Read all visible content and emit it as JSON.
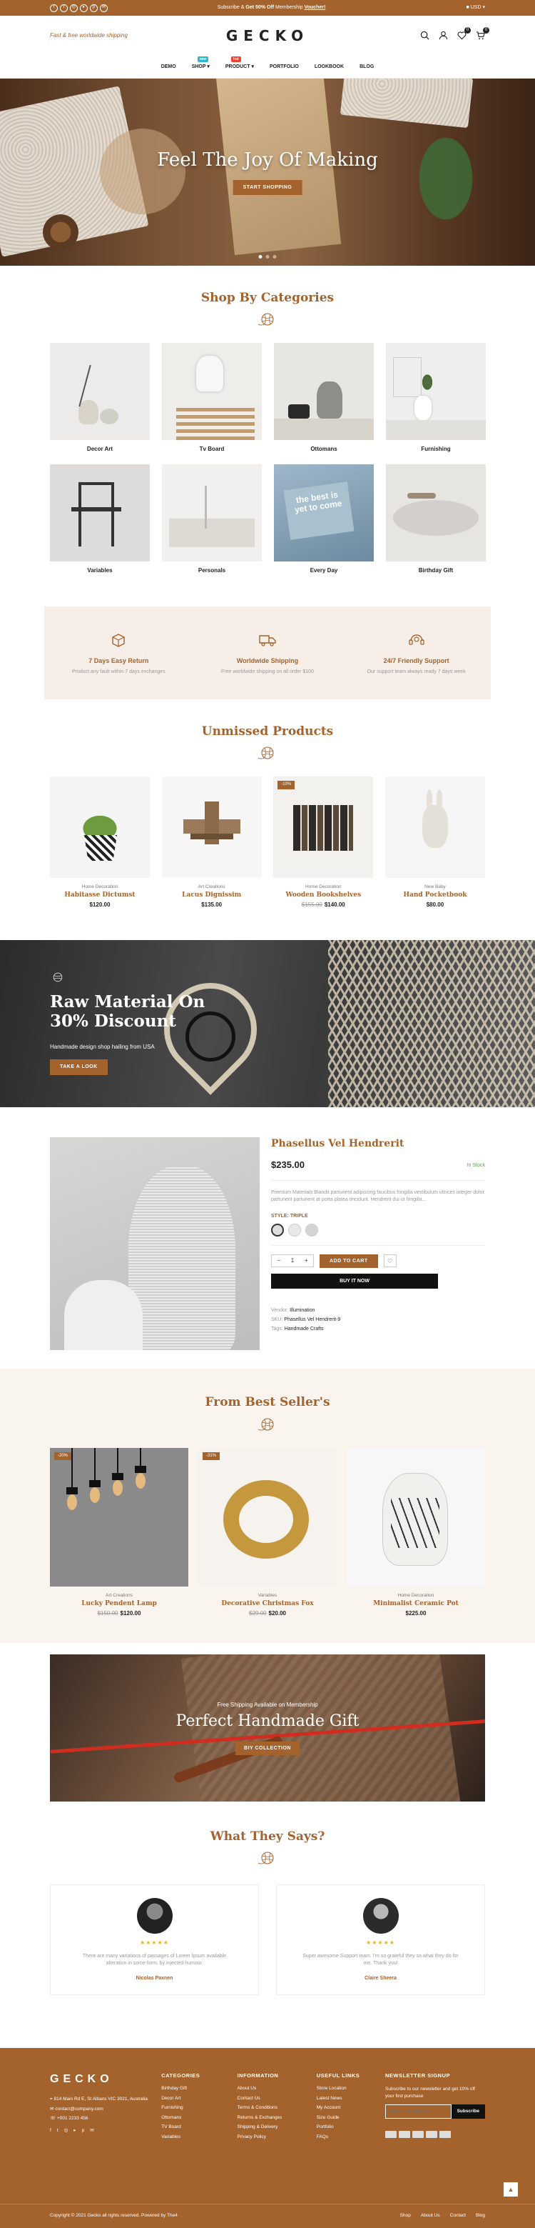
{
  "topbar": {
    "social_icons": [
      "facebook-icon",
      "twitter-icon",
      "instagram-icon",
      "youtube-icon",
      "pinterest-icon",
      "mail-icon"
    ],
    "promo_prefix": "Subscribe & ",
    "promo_highlight": "Get 50% Off",
    "promo_suffix": " Membership ",
    "promo_link": "Voucher!",
    "currency": "USD"
  },
  "header": {
    "tagline": "Fast & free worldwide shipping",
    "logo": "GECKO",
    "wishlist_count": "0",
    "cart_count": "0"
  },
  "nav": {
    "items": [
      {
        "label": "DEMO"
      },
      {
        "label": "SHOP",
        "badge": "new",
        "badge_color": "#2bb6d4"
      },
      {
        "label": "PRODUCT",
        "badge": "hot",
        "badge_color": "#e8442f"
      },
      {
        "label": "PORTFOLIO"
      },
      {
        "label": "LOOKBOOK"
      },
      {
        "label": "BLOG"
      }
    ]
  },
  "hero": {
    "title": "Feel The Joy Of Making",
    "button": "START SHOPPING"
  },
  "categories": {
    "title": "Shop By Categories",
    "items": [
      {
        "name": "Decor Art"
      },
      {
        "name": "Tv Board"
      },
      {
        "name": "Ottomans"
      },
      {
        "name": "Furnishing"
      },
      {
        "name": "Variables"
      },
      {
        "name": "Personals"
      },
      {
        "name": "Every Day"
      },
      {
        "name": "Birthday Gift"
      }
    ],
    "every_day_caption": "the best is yet to come"
  },
  "features": [
    {
      "title": "7 Days Easy Return",
      "desc": "Product any fault within 7 days exchanges"
    },
    {
      "title": "Worldwide Shipping",
      "desc": "Free worldwide shipping on all order $100"
    },
    {
      "title": "24/7 Friendly Support",
      "desc": "Our support team always ready 7 days week"
    }
  ],
  "unmissed": {
    "title": "Unmissed Products",
    "items": [
      {
        "category": "Home Decoration",
        "name": "Habitasse Dictumst",
        "price": "$120.00",
        "old": "",
        "tag": ""
      },
      {
        "category": "Art Creations",
        "name": "Lacus Dignissim",
        "price": "$135.00",
        "old": "",
        "tag": ""
      },
      {
        "category": "Home Decoration",
        "name": "Wooden Bookshelves",
        "price": "$140.00",
        "old": "$155.00",
        "tag": "-10%"
      },
      {
        "category": "New Baby",
        "name": "Hand Pocketbook",
        "price": "$80.00",
        "old": "",
        "tag": ""
      }
    ]
  },
  "banner": {
    "line1": "Raw Material On",
    "line2": "30% Discount",
    "sub": "Handmade design shop hailing from USA",
    "button": "TAKE A LOOK"
  },
  "featured": {
    "name": "Phasellus Vel Hendrerit",
    "price": "$235.00",
    "stock": "In Stock",
    "desc": "Premium Materials Blandit parturient adipiscing faucibus fringilla vestibulum ultrices integer dolor parturient parturient at porta platea tincidunt. Hendrerit dui ut fringilla...",
    "style_label": "STYLE: TRIPLE",
    "qty": "1",
    "add_to_cart": "ADD TO CART",
    "buy_now": "BUY IT NOW",
    "vendor_label": "Vendor:",
    "vendor": "Illumination",
    "sku_label": "SKU:",
    "sku": "Phasellus Vel Hendrerit-9",
    "tags_label": "Tags:",
    "tags": "Handmade Crafts"
  },
  "bestseller": {
    "title": "From Best Seller's",
    "items": [
      {
        "category": "Art Creations",
        "name": "Lucky Pendent Lamp",
        "price": "$120.00",
        "old": "$150.00",
        "tag": "-20%"
      },
      {
        "category": "Variables",
        "name": "Decorative Christmas Fox",
        "price": "$20.00",
        "old": "$29.00",
        "tag": "-31%"
      },
      {
        "category": "Home Decoration",
        "name": "Minimalist Ceramic Pot",
        "price": "$225.00",
        "old": "",
        "tag": ""
      }
    ]
  },
  "gift": {
    "sub": "Free Shipping Available on Membership",
    "title": "Perfect Handmade Gift",
    "button": "BIY COLLECTION"
  },
  "testimonials": {
    "title": "What They Says?",
    "items": [
      {
        "stars": "★★★★★",
        "text": "There are many variations of passages of Lorem Ipsum available alteration in some form, by injected humour.",
        "author": "Nicolas Paxnen"
      },
      {
        "stars": "★★★★★",
        "text": "Super awesome Support team. I'm so grateful they so what they do for me. Thank you!",
        "author": "Claire Sheera"
      }
    ]
  },
  "footer": {
    "logo": "GECKO",
    "address": "814 Main Rd E, St Albans VIC 3021, Australia",
    "email": "contact@company.com",
    "phone": "+001 2233 456",
    "social_icons": [
      "facebook-icon",
      "twitter-icon",
      "instagram-icon",
      "youtube-icon",
      "pinterest-icon",
      "mail-icon"
    ],
    "cols": [
      {
        "title": "CATEGORIES",
        "links": [
          "Birthday Gift",
          "Decor Art",
          "Furnishing",
          "Ottomans",
          "TV Board",
          "Variables"
        ]
      },
      {
        "title": "INFORMATION",
        "links": [
          "About Us",
          "Contact Us",
          "Terms & Conditions",
          "Returns & Exchanges",
          "Shipping & Delivery",
          "Privacy Policy"
        ]
      },
      {
        "title": "USEFUL LINKS",
        "links": [
          "Store Location",
          "Latest News",
          "My Account",
          "Size Guide",
          "Portfolio",
          "FAQs"
        ]
      }
    ],
    "newsletter_title": "NEWSLETTER SIGNUP",
    "newsletter_desc": "Subscribe to our newsletter and get 10% off your first purchase",
    "newsletter_placeholder": "Your email address",
    "newsletter_button": "Subscribe",
    "copyright": "Copyright © 2021 Gecko all rights reserved. Powered by The4",
    "bottom_links": [
      "Shop",
      "About Us",
      "Contact",
      "Blog"
    ]
  }
}
